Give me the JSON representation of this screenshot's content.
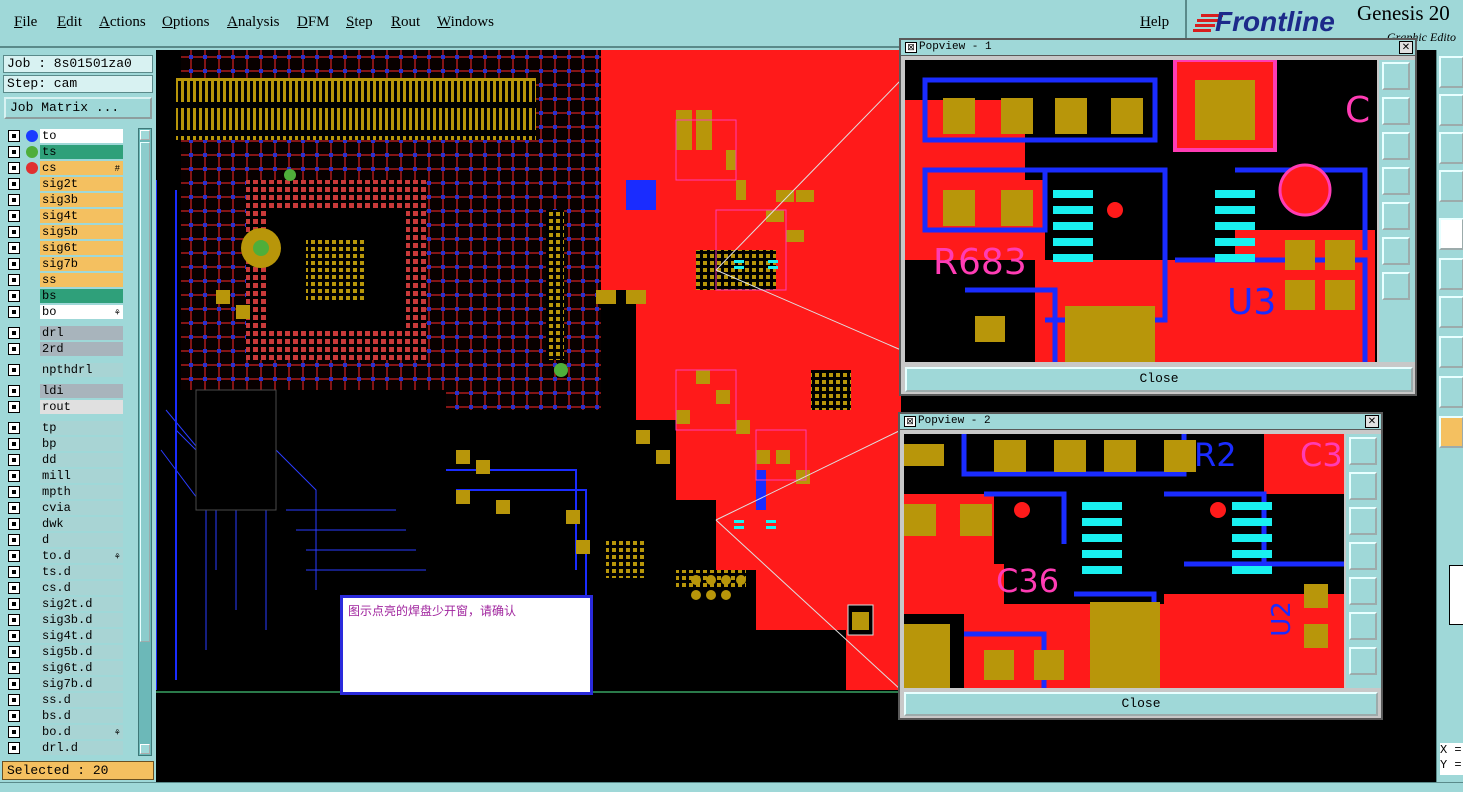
{
  "menubar": {
    "items": [
      "File",
      "Edit",
      "Actions",
      "Options",
      "Analysis",
      "DFM",
      "Step",
      "Rout",
      "Windows"
    ],
    "help": "Help"
  },
  "brand": {
    "logo": "Frontline",
    "title": "Genesis 20",
    "subtitle": "Graphic Edito"
  },
  "job": {
    "job_label": "Job : 8s01501za0",
    "step_label": "Step: cam",
    "matrix_button": "Job Matrix ..."
  },
  "layers": [
    {
      "name": "to",
      "color": "#ffffff",
      "marker": "#1a3cff",
      "corner": ""
    },
    {
      "name": "ts",
      "color": "#2fa07a",
      "marker": "#4fae3a",
      "corner": ""
    },
    {
      "name": "cs",
      "color": "#f4c060",
      "marker": "#e03030",
      "corner": "#"
    },
    {
      "name": "sig2t",
      "color": "#f4c060",
      "marker": "",
      "corner": ""
    },
    {
      "name": "sig3b",
      "color": "#f4c060",
      "marker": "",
      "corner": ""
    },
    {
      "name": "sig4t",
      "color": "#f4c060",
      "marker": "",
      "corner": ""
    },
    {
      "name": "sig5b",
      "color": "#f4c060",
      "marker": "",
      "corner": ""
    },
    {
      "name": "sig6t",
      "color": "#f4c060",
      "marker": "",
      "corner": ""
    },
    {
      "name": "sig7b",
      "color": "#f4c060",
      "marker": "",
      "corner": ""
    },
    {
      "name": "ss",
      "color": "#f4c060",
      "marker": "",
      "corner": ""
    },
    {
      "name": "bs",
      "color": "#2fa07a",
      "marker": "",
      "corner": ""
    },
    {
      "name": "bo",
      "color": "#ffffff",
      "marker": "",
      "corner": "⚘"
    },
    {
      "name": "",
      "color": "",
      "marker": "",
      "corner": "",
      "gap": true
    },
    {
      "name": "drl",
      "color": "#a8b4bc",
      "marker": "",
      "corner": ""
    },
    {
      "name": "2rd",
      "color": "#a8b4bc",
      "marker": "",
      "corner": ""
    },
    {
      "name": "",
      "color": "",
      "marker": "",
      "corner": "",
      "gap": true
    },
    {
      "name": "npthdrl",
      "color": "#a8d4d4",
      "marker": "",
      "corner": ""
    },
    {
      "name": "",
      "color": "",
      "marker": "",
      "corner": "",
      "gap": true
    },
    {
      "name": "ldi",
      "color": "#a8b4bc",
      "marker": "",
      "corner": ""
    },
    {
      "name": "rout",
      "color": "#e0e0e0",
      "marker": "",
      "corner": ""
    },
    {
      "name": "",
      "color": "",
      "marker": "",
      "corner": "",
      "gap": true
    },
    {
      "name": "tp",
      "color": "#a8d4d4",
      "marker": "",
      "corner": ""
    },
    {
      "name": "bp",
      "color": "#a8d4d4",
      "marker": "",
      "corner": ""
    },
    {
      "name": "dd",
      "color": "#a8d4d4",
      "marker": "",
      "corner": ""
    },
    {
      "name": "mill",
      "color": "#a8d4d4",
      "marker": "",
      "corner": ""
    },
    {
      "name": "mpth",
      "color": "#a8d4d4",
      "marker": "",
      "corner": ""
    },
    {
      "name": "cvia",
      "color": "#a8d4d4",
      "marker": "",
      "corner": ""
    },
    {
      "name": "dwk",
      "color": "#a8d4d4",
      "marker": "",
      "corner": ""
    },
    {
      "name": "d",
      "color": "#a8d4d4",
      "marker": "",
      "corner": ""
    },
    {
      "name": "to.d",
      "color": "#a8d4d4",
      "marker": "",
      "corner": "⚘"
    },
    {
      "name": "ts.d",
      "color": "#a8d4d4",
      "marker": "",
      "corner": ""
    },
    {
      "name": "cs.d",
      "color": "#a8d4d4",
      "marker": "",
      "corner": ""
    },
    {
      "name": "sig2t.d",
      "color": "#a8d4d4",
      "marker": "",
      "corner": ""
    },
    {
      "name": "sig3b.d",
      "color": "#a8d4d4",
      "marker": "",
      "corner": ""
    },
    {
      "name": "sig4t.d",
      "color": "#a8d4d4",
      "marker": "",
      "corner": ""
    },
    {
      "name": "sig5b.d",
      "color": "#a8d4d4",
      "marker": "",
      "corner": ""
    },
    {
      "name": "sig6t.d",
      "color": "#a8d4d4",
      "marker": "",
      "corner": ""
    },
    {
      "name": "sig7b.d",
      "color": "#a8d4d4",
      "marker": "",
      "corner": ""
    },
    {
      "name": "ss.d",
      "color": "#a8d4d4",
      "marker": "",
      "corner": ""
    },
    {
      "name": "bs.d",
      "color": "#a8d4d4",
      "marker": "",
      "corner": ""
    },
    {
      "name": "bo.d",
      "color": "#a8d4d4",
      "marker": "",
      "corner": "⚘"
    },
    {
      "name": "drl.d",
      "color": "#a8d4d4",
      "marker": "",
      "corner": ""
    }
  ],
  "status": {
    "selected": "Selected : 20"
  },
  "coords": {
    "x_label": "X =",
    "y_label": "Y ="
  },
  "popview1": {
    "title": "Popview - 1",
    "close_label": "Close",
    "labels": [
      "R683",
      "U3",
      "C"
    ]
  },
  "popview2": {
    "title": "Popview - 2",
    "close_label": "Close",
    "labels": [
      "R2",
      "C3",
      "C36",
      "U2"
    ]
  },
  "note": {
    "text": "图示点亮的焊盘少开窗，请确认"
  },
  "colors": {
    "panel": "#9fd8d8",
    "copper_red": "#ff1a1a",
    "pad_gold": "#b8960a",
    "outline_blue": "#1a2cff",
    "highlight_cyan": "#19f0f0",
    "silk_pink": "#ff3cb4"
  }
}
